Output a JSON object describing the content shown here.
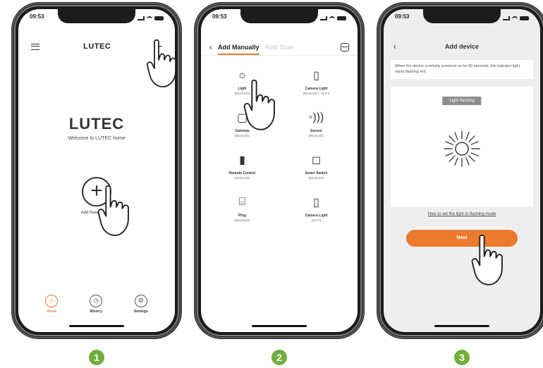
{
  "steps": [
    "1",
    "2",
    "3"
  ],
  "status": {
    "time": "09:53"
  },
  "screen1": {
    "title": "LUTEC",
    "logo_main": "LUTEC",
    "welcome": "Welcome to LUTEC home",
    "add_symbol": "+",
    "add_label": "Add New Device",
    "tabs": [
      {
        "label": "Home",
        "icon": "home-icon",
        "active": true
      },
      {
        "label": "Mistery",
        "icon": "history-icon",
        "active": false
      },
      {
        "label": "Settings",
        "icon": "settings-icon",
        "active": false
      }
    ]
  },
  "screen2": {
    "tab_active": "Add Manually",
    "tab_inactive": "Auto Scan",
    "devices": [
      {
        "name": "Light",
        "sub": "(Bluetooth)",
        "icon": "light-icon"
      },
      {
        "name": "Camera Light",
        "sub": "(Bluetooth + Wi-Fi)",
        "icon": "camera-light-icon"
      },
      {
        "name": "Gateway",
        "sub": "(Bluetooth)",
        "icon": "gateway-icon"
      },
      {
        "name": "Sensor",
        "sub": "(Bluetooth)",
        "icon": "sensor-icon"
      },
      {
        "name": "Remote Control",
        "sub": "(Bluetooth)",
        "icon": "remote-icon"
      },
      {
        "name": "Smart Switch",
        "sub": "(Bluetooth)",
        "icon": "switch-icon"
      },
      {
        "name": "Plug",
        "sub": "(Bluetooth)",
        "icon": "plug-icon"
      },
      {
        "name": "Camera Light",
        "sub": "(Wi-Fi)",
        "icon": "camera-light-icon"
      }
    ]
  },
  "screen3": {
    "title": "Add device",
    "info": "When the device is initially powered on for 60 seconds, the indicator light starts flashing red.",
    "chip": "Light flashing",
    "link": "How to set the light to flashing mode",
    "next": "Next"
  },
  "colors": {
    "accent": "#ea7a2e",
    "brand_green": "#73ad3d",
    "step_badge": "#73ad3d"
  }
}
